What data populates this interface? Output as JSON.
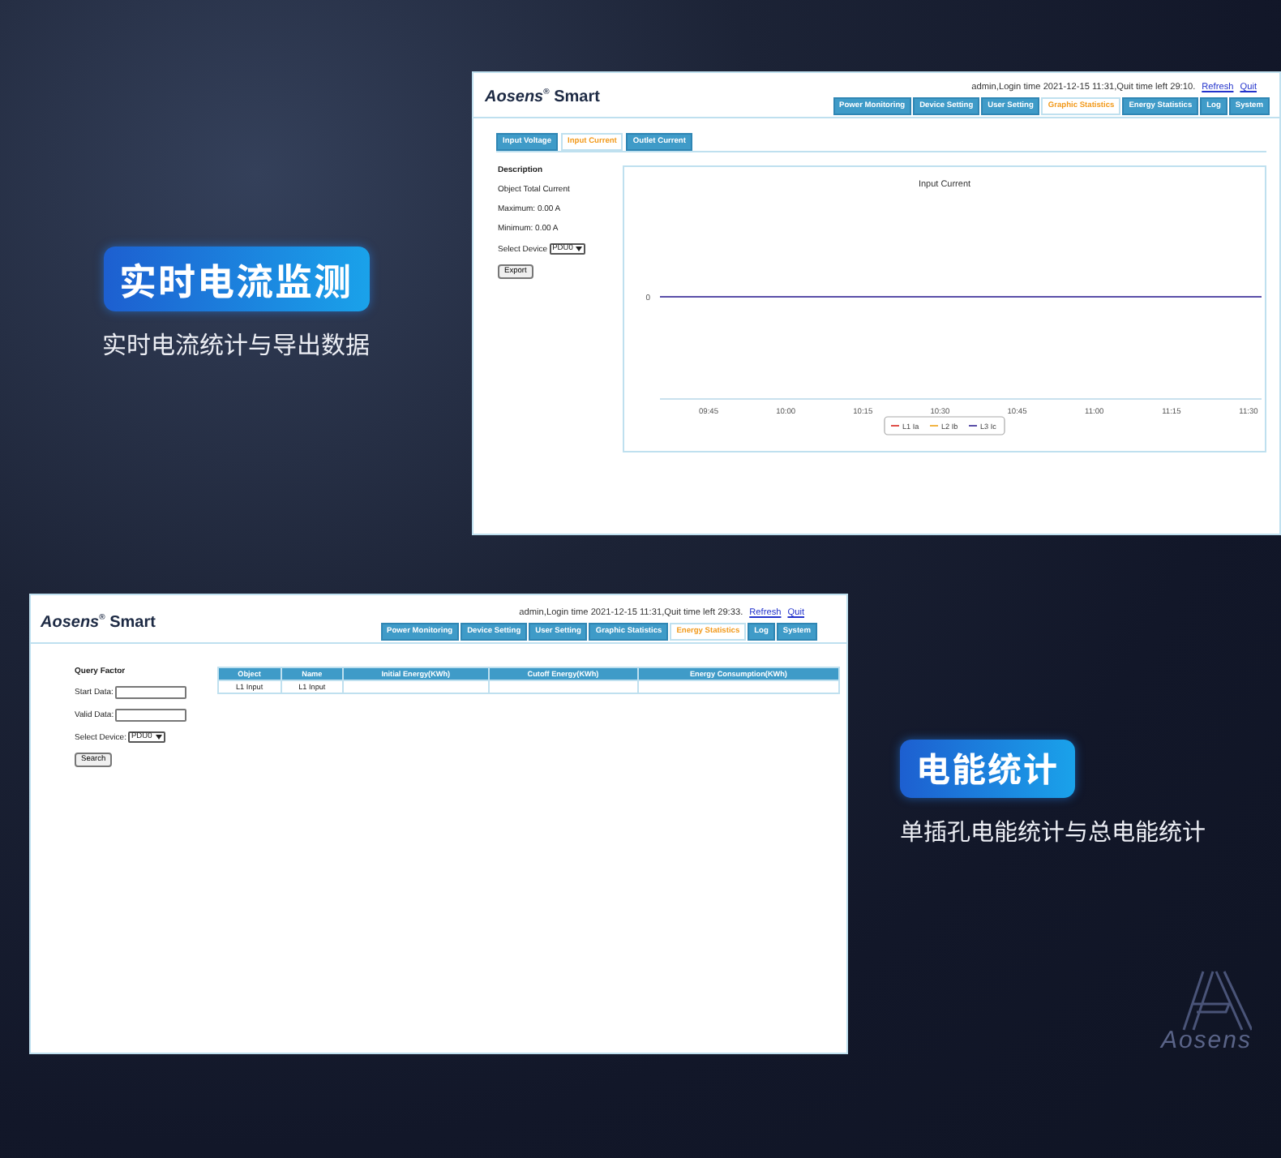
{
  "features": [
    {
      "badge": "实时电流监测",
      "subtitle": "实时电流统计与导出数据"
    },
    {
      "badge": "电能统计",
      "subtitle": "单插孔电能统计与总电能统计"
    }
  ],
  "current_screen": {
    "logo": "*Aosens*$^{®}$ Smart",
    "session": "admin,Login time 2021-12-15 11:31,Quit time left 29:10.",
    "links": [
      "Refresh",
      "Quit"
    ],
    "nav": [
      {
        "label": "Power Monitoring",
        "selected": false
      },
      {
        "label": "Device Setting",
        "selected": false
      },
      {
        "label": "User Setting",
        "selected": false
      },
      {
        "label": "Graphic Statistics",
        "selected": true
      },
      {
        "label": "Energy Statistics",
        "selected": false
      },
      {
        "label": "Log",
        "selected": false
      },
      {
        "label": "System",
        "selected": false
      }
    ],
    "subtabs": [
      {
        "label": "Input Voltage",
        "selected": false
      },
      {
        "label": "Input Current",
        "selected": true
      },
      {
        "label": "Outlet Current",
        "selected": false
      }
    ],
    "panel": {
      "heading": "Description",
      "lines": [
        "Object Total Current",
        "Maximum: 0.00 A",
        "Minimum: 0.00 A"
      ],
      "device_label": "Select Device",
      "device": "PDU0",
      "button": "Export"
    },
    "chart": {
      "title": "Input Current",
      "y_label": "0",
      "x_labels": [
        "09:45",
        "10:00",
        "10:15",
        "10:30",
        "10:45",
        "11:00",
        "11:15",
        "11:30"
      ],
      "legend": [
        {
          "name": "L1 Ia",
          "color": "#e0504a"
        },
        {
          "name": "L2 Ib",
          "color": "#f2b544"
        },
        {
          "name": "L3 Ic",
          "color": "#5a4fa8"
        }
      ]
    }
  },
  "energy_screen": {
    "logo": "*Aosens*$^{®}$ Smart",
    "session": "admin,Login time 2021-12-15 11:31,Quit time left 29:33.",
    "links": [
      "Refresh",
      "Quit"
    ],
    "nav": [
      {
        "label": "Power Monitoring",
        "selected": false
      },
      {
        "label": "Device Setting",
        "selected": false
      },
      {
        "label": "User Setting",
        "selected": false
      },
      {
        "label": "Graphic Statistics",
        "selected": false
      },
      {
        "label": "Energy Statistics",
        "selected": true
      },
      {
        "label": "Log",
        "selected": false
      },
      {
        "label": "System",
        "selected": false
      }
    ],
    "query": {
      "heading": "Query Factor",
      "fields": [
        "Start Data:",
        "Valid Data:"
      ],
      "device_label": "Select Device:",
      "device": "PDU0",
      "button": "Search"
    },
    "table": {
      "columns": [
        "Object",
        "Name",
        "Initial Energy(KWh)",
        "Cutoff Energy(KWh)",
        "Energy Consumption(KWh)"
      ],
      "rows": [
        [
          "L1 Input",
          "L1 Input",
          "",
          "",
          ""
        ]
      ]
    }
  },
  "brand_mark": "Aosens"
}
